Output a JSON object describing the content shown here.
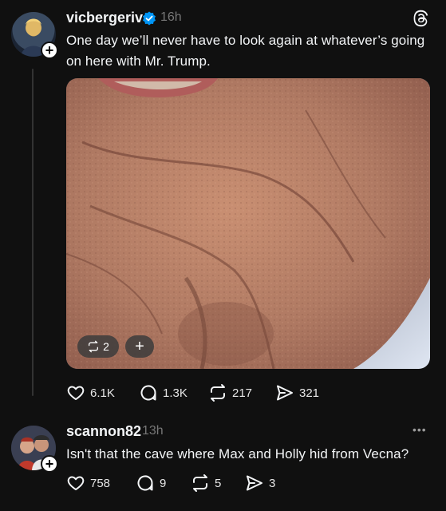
{
  "post": {
    "username": "vicbergeriv",
    "verified": true,
    "time": "16h",
    "text_line1": "One day we’ll never have to look again at whatever’s going",
    "text_line2": "on here with Mr. Trump.",
    "image_overlay": {
      "repost_count": "2",
      "plus_label": "+"
    },
    "actions": {
      "likes": "6.1K",
      "replies": "1.3K",
      "reposts": "217",
      "shares": "321"
    }
  },
  "reply": {
    "username": "scannon82",
    "time": "13h",
    "text": "Isn't that the cave where Max and Holly hid from Vecna?",
    "more_label": "•••",
    "actions": {
      "likes": "758",
      "replies": "9",
      "reposts": "5",
      "shares": "3"
    }
  },
  "icons": {
    "app_logo": "threads-logo-icon",
    "verified": "verified-badge-icon",
    "like": "heart-icon",
    "reply": "comment-icon",
    "repost": "repost-icon",
    "share": "send-icon",
    "follow": "plus-icon"
  },
  "colors": {
    "background": "#101010",
    "text": "#f3f5f7",
    "muted": "#777777",
    "verified": "#0095f6"
  }
}
